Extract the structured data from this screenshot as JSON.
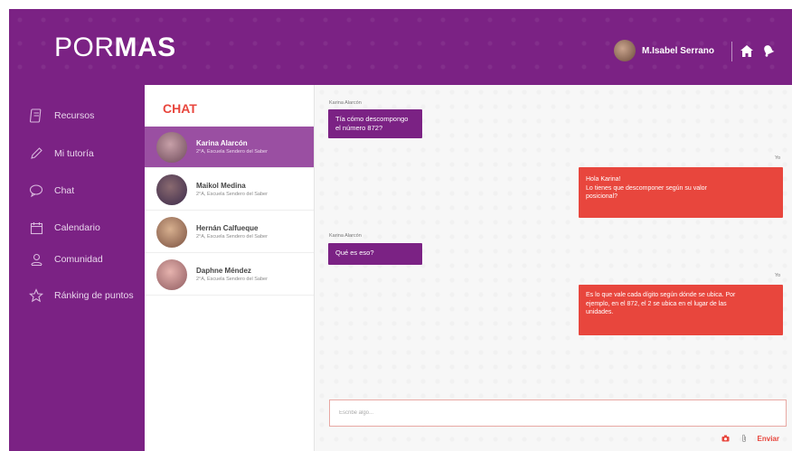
{
  "header": {
    "logo_light": "POR",
    "logo_bold": "MAS",
    "user_name": "M.Isabel Serrano"
  },
  "icons": {
    "home": "home-icon",
    "notifications": "bell-icon",
    "camera": "camera-icon",
    "attach": "paperclip-icon"
  },
  "sidebar": {
    "items": [
      {
        "label": "Recursos",
        "icon": "book-icon"
      },
      {
        "label": "Mi tutoría",
        "icon": "pencil-icon"
      },
      {
        "label": "Chat",
        "icon": "chat-bubble-icon"
      },
      {
        "label": "Calendario",
        "icon": "calendar-icon"
      },
      {
        "label": "Comunidad",
        "icon": "people-icon"
      },
      {
        "label": "Ránking de puntos",
        "icon": "star-icon"
      }
    ]
  },
  "chat_list": {
    "title": "CHAT",
    "contacts": [
      {
        "name": "Karina Alarcón",
        "sub": "2°A, Escuela Sendero del Saber",
        "active": true
      },
      {
        "name": "Maikol Medina",
        "sub": "2°A, Escuela Sendero del Saber",
        "active": false
      },
      {
        "name": "Hernán Calfueque",
        "sub": "2°A, Escuela Sendero del Saber",
        "active": false
      },
      {
        "name": "Daphne Méndez",
        "sub": "2°A, Escuela Sendero del Saber",
        "active": false
      }
    ]
  },
  "conversation": {
    "messages": [
      {
        "from": "Karina Alarcón",
        "side": "in",
        "lines": [
          "Tía cómo descompongo",
          "el número 872?"
        ]
      },
      {
        "from": "Yo",
        "side": "out",
        "lines": [
          "Hola Karina!",
          "Lo tienes que descomponer según su valor",
          "posicional?"
        ]
      },
      {
        "from": "Karina Alarcón",
        "side": "in",
        "lines": [
          "Qué es eso?"
        ]
      },
      {
        "from": "Yo",
        "side": "out",
        "lines": [
          "Es lo que vale cada dígito según dónde se ubica. Por",
          "ejemplo, en el 872, el 2 se ubica en el lugar de las",
          "unidades."
        ]
      }
    ]
  },
  "compose": {
    "placeholder": "Escribe algo...",
    "send_label": "Enviar"
  },
  "colors": {
    "primary": "#7b2284",
    "accent": "#e8463d",
    "active_contact": "#9a4fa2"
  }
}
